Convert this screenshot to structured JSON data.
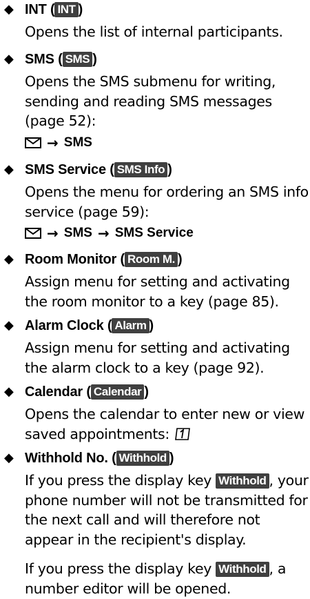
{
  "items": [
    {
      "name": "INT",
      "paren_open": " (",
      "key": "INT",
      "paren_close": ")",
      "desc": "Opens the list of internal participants."
    },
    {
      "name": "SMS",
      "paren_open": "  (",
      "key": "SMS",
      "paren_close": ")",
      "desc": "Opens the SMS submenu for writing, sending and reading SMS messages (page 52):",
      "path": [
        "SMS"
      ]
    },
    {
      "name": "SMS Service",
      "paren_open": "  (",
      "key": "SMS Info",
      "paren_close": ")",
      "desc": "Opens the menu for ordering an SMS info service (page 59):",
      "path": [
        "SMS",
        "SMS Service"
      ]
    },
    {
      "name": "Room Monitor",
      "paren_open": " (",
      "key": "Room M.",
      "paren_close": ")",
      "desc": "Assign menu for setting and activating the room monitor to a key (page 85)."
    },
    {
      "name": "Alarm Clock",
      "paren_open": " (",
      "key": "Alarm",
      "paren_close": ")",
      "desc": "Assign menu for setting and activating the alarm clock to a key (page 92)."
    },
    {
      "name": "Calendar",
      "paren_open": " (",
      "key": "Calendar",
      "paren_close": ")",
      "desc": "Opens the calendar to enter new or view saved appointments: "
    },
    {
      "name": "Withhold No.",
      "paren_open": "  (",
      "key": "Withhold",
      "paren_close": ")",
      "desc_pre": "If you press the display key ",
      "desc_key": "Withhold",
      "desc_post": ", your phone number will not be transmitted for the next call and will therefore not appear in the recipient's display.",
      "desc2_pre": "If you press the display key ",
      "desc2_key": "Withhold",
      "desc2_post": ", a number editor will be opened."
    }
  ],
  "icons": {
    "bullet": "diamond-bullet-icon",
    "message": "envelope-icon",
    "arrow": "right-arrow-icon",
    "key_1": "digit-one-key-icon"
  },
  "colors": {
    "key_bg": "#404040",
    "key_fg": "#ffffff",
    "text": "#000000"
  }
}
